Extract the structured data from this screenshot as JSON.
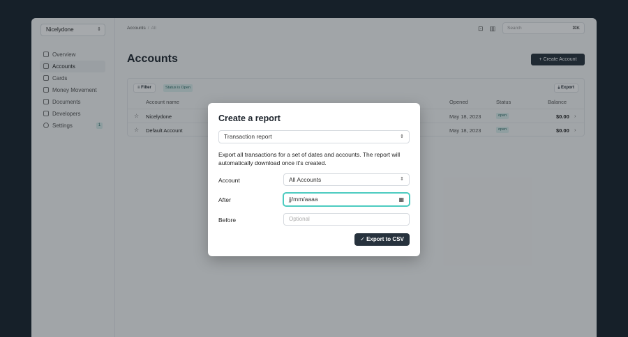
{
  "sidebar": {
    "org": "Nicelydone",
    "items": [
      {
        "label": "Overview"
      },
      {
        "label": "Accounts"
      },
      {
        "label": "Cards"
      },
      {
        "label": "Money Movement"
      },
      {
        "label": "Documents"
      },
      {
        "label": "Developers"
      },
      {
        "label": "Settings",
        "badge": "1"
      }
    ]
  },
  "header": {
    "breadcrumb": [
      "Accounts",
      "All"
    ],
    "search_placeholder": "Search",
    "search_shortcut": "⌘K"
  },
  "page": {
    "title": "Accounts",
    "create_label": "Create Account",
    "filter_label": "Filter",
    "status_chip": "Status is Open",
    "export_label": "Export",
    "columns": [
      "Account name",
      "Opened",
      "Status",
      "Balance"
    ],
    "rows": [
      {
        "name": "Nicelydone",
        "opened": "May 18, 2023",
        "status": "open",
        "balance": "$0.00"
      },
      {
        "name": "Default Account",
        "opened": "May 18, 2023",
        "status": "open",
        "balance": "$0.00"
      }
    ]
  },
  "modal": {
    "title": "Create a report",
    "report_type": "Transaction report",
    "description": "Export all transactions for a set of dates and accounts. The report will automatically download once it's created.",
    "account_label": "Account",
    "account_value": "All Accounts",
    "after_label": "After",
    "after_value": "jj/mm/aaaa",
    "before_label": "Before",
    "before_placeholder": "Optional",
    "submit_label": "Export to CSV"
  },
  "colors": {
    "accent": "#4ccbc0",
    "primary_button": "#27323d",
    "backdrop": "#18222d"
  }
}
